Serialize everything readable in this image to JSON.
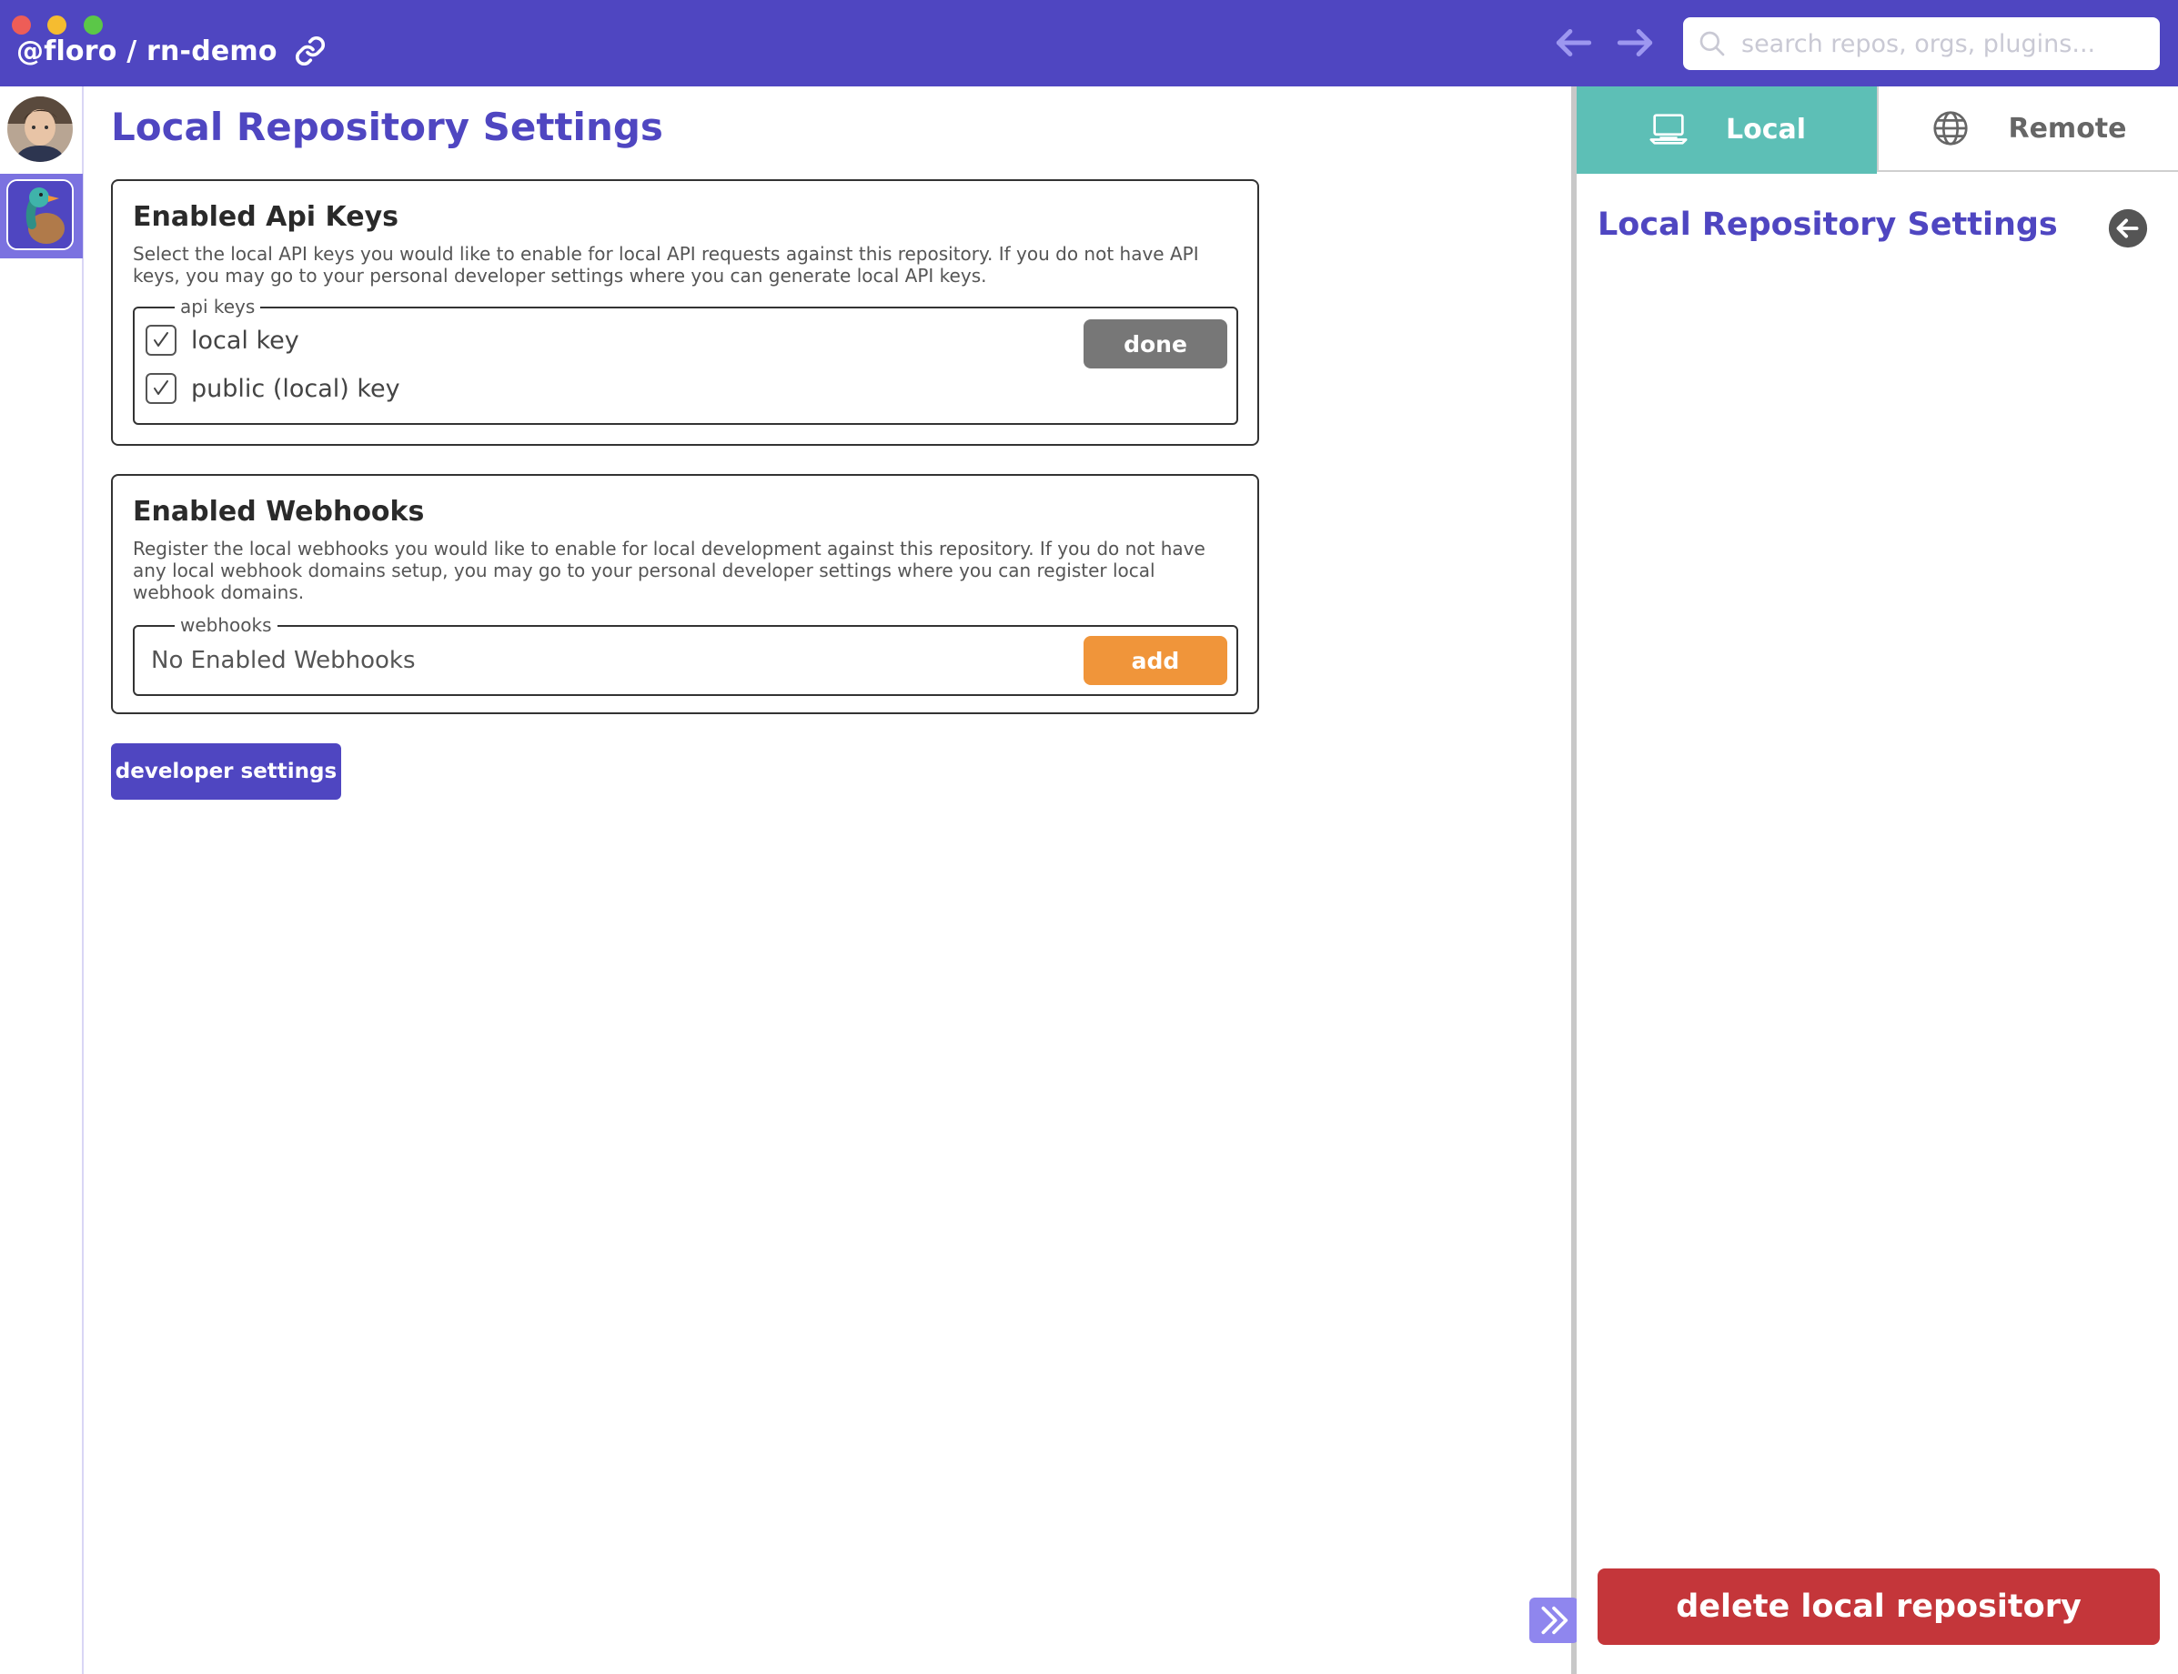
{
  "window": {
    "repo_path": "@floro / rn-demo"
  },
  "search": {
    "placeholder": "search repos, orgs, plugins..."
  },
  "main": {
    "title": "Local Repository Settings",
    "api_keys": {
      "title": "Enabled Api Keys",
      "description": "Select the local API keys you would like to enable for local API requests against this repository. If you do not have API keys, you may go to your personal developer settings where you can generate local API keys.",
      "legend": "api keys",
      "keys": [
        {
          "label": "local key",
          "checked": true
        },
        {
          "label": "public (local) key",
          "checked": true
        }
      ],
      "done_label": "done"
    },
    "webhooks": {
      "title": "Enabled Webhooks",
      "description": "Register the local webhooks you would like to enable for local development against this repository. If you do not have any local webhook domains setup, you may go to your personal developer settings where you can register local webhook domains.",
      "legend": "webhooks",
      "empty_text": "No Enabled Webhooks",
      "add_label": "add"
    },
    "developer_settings_label": "developer settings"
  },
  "right_panel": {
    "tabs": [
      {
        "label": "Local",
        "active": true
      },
      {
        "label": "Remote",
        "active": false
      }
    ],
    "title": "Local Repository Settings",
    "delete_label": "delete local repository"
  },
  "colors": {
    "brand": "#4f46c1",
    "local_tab": "#5dbfb6",
    "add_button": "#f0953a",
    "delete_button": "#c4363a",
    "done_button": "#777777"
  },
  "icons": {
    "link": "link-icon",
    "back": "arrow-left-icon",
    "forward": "arrow-right-icon",
    "search": "search-icon",
    "laptop": "laptop-icon",
    "globe": "globe-icon",
    "expand": "double-chevron-right-icon"
  }
}
